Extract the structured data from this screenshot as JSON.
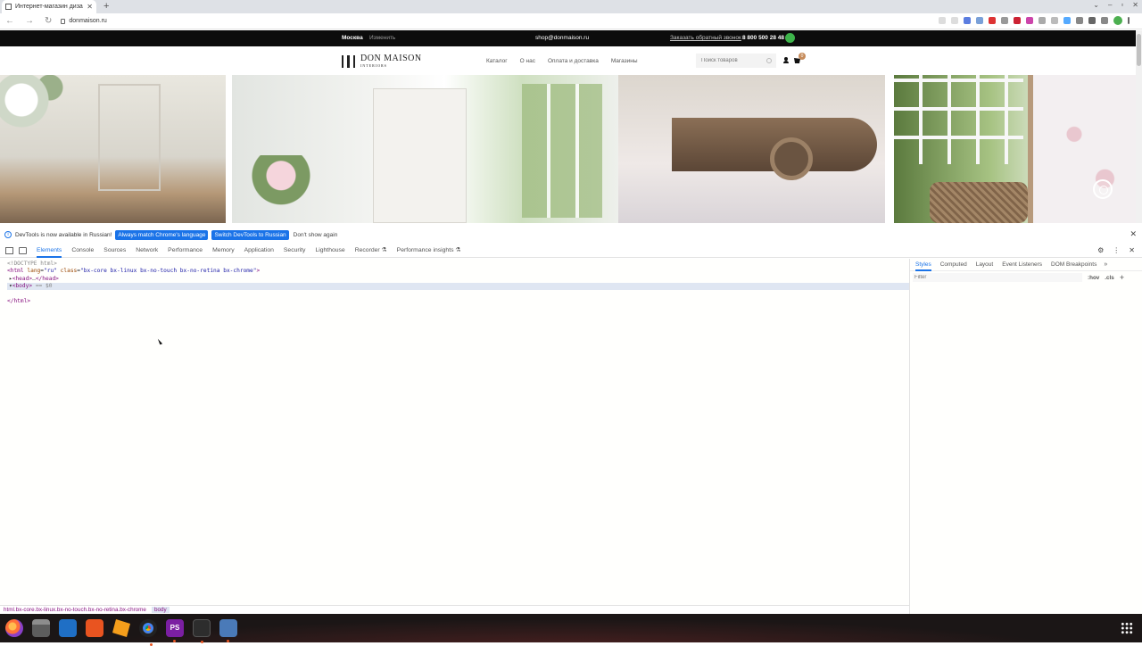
{
  "browser": {
    "tab_title": "Интернет-магазин диза",
    "url": "donmaison.ru"
  },
  "site": {
    "city": "Москва",
    "change_city": "Изменить",
    "email": "shop@donmaison.ru",
    "callback": "Заказать обратный звонок",
    "phone": "8 800 500 28 48",
    "logo_title": "DON  MAISON",
    "logo_sub": "INTERIORS",
    "menu": [
      "Каталог",
      "О нас",
      "Оплата и доставка",
      "Магазины"
    ],
    "search_placeholder": "Поиск товаров",
    "cart_count": "0"
  },
  "devtools": {
    "info_text": "DevTools is now available in Russian!",
    "btn_match": "Always match Chrome's language",
    "btn_switch": "Switch DevTools to Russian",
    "btn_dont_show": "Don't show again",
    "tabs": [
      "Elements",
      "Console",
      "Sources",
      "Network",
      "Performance",
      "Memory",
      "Application",
      "Security",
      "Lighthouse",
      "Recorder ⚗",
      "Performance insights ⚗"
    ],
    "dom": {
      "doctype": "<!DOCTYPE html>",
      "html_open_tag": "<html",
      "html_attr_lang": "lang",
      "html_attr_lang_val": "\"ru\"",
      "html_attr_class": "class",
      "html_attr_class_val": "\"bx-core bx-linux bx-no-touch bx-no-retina bx-chrome\"",
      "head": "<head>",
      "head_ellipsis": "…",
      "head_close": "</head>",
      "body": "<body>",
      "body_marker": "== $0",
      "html_close": "</html>"
    },
    "styles_tabs": [
      "Styles",
      "Computed",
      "Layout",
      "Event Listeners",
      "DOM Breakpoints"
    ],
    "filter_placeholder": "Filter",
    "hov": ":hov",
    "cls": ".cls",
    "breadcrumbs": [
      "html.bx-core.bx-linux.bx-no-touch.bx-no-retina.bx-chrome",
      "body"
    ]
  },
  "taskbar": {
    "apps": [
      "firefox-icon",
      "files-icon",
      "writer-icon",
      "app-store-icon",
      "sublime-icon",
      "chrome-icon",
      "phpstorm-icon",
      "terminal-icon",
      "settings-icon"
    ],
    "ps_label": "PS"
  },
  "colors": {
    "accent": "#1a73e8",
    "whatsapp": "#3db34a",
    "cart_badge": "#c68b5a"
  }
}
